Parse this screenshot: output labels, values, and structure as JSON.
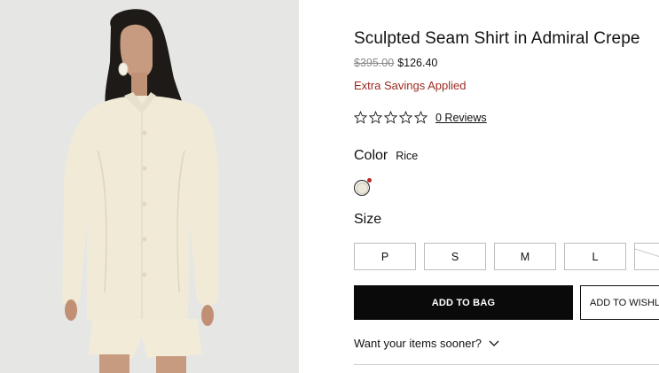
{
  "product": {
    "title": "Sculpted Seam Shirt in Admiral Crepe",
    "original_price": "$395.00",
    "sale_price": "$126.40",
    "savings_note": "Extra Savings Applied",
    "rating_stars": 0,
    "reviews_label": "0 Reviews"
  },
  "color": {
    "label": "Color",
    "selected": "Rice",
    "swatch_hex": "#ece8db"
  },
  "size": {
    "label": "Size",
    "options": [
      "P",
      "S",
      "M",
      "L",
      ""
    ]
  },
  "actions": {
    "add_to_bag": "ADD TO BAG",
    "add_to_wishlist": "ADD TO WISHLIST"
  },
  "delivery": {
    "prompt": "Want your items sooner?"
  },
  "colors": {
    "accent_savings": "#9a2a1f",
    "button_dark": "#0a0a0a"
  }
}
